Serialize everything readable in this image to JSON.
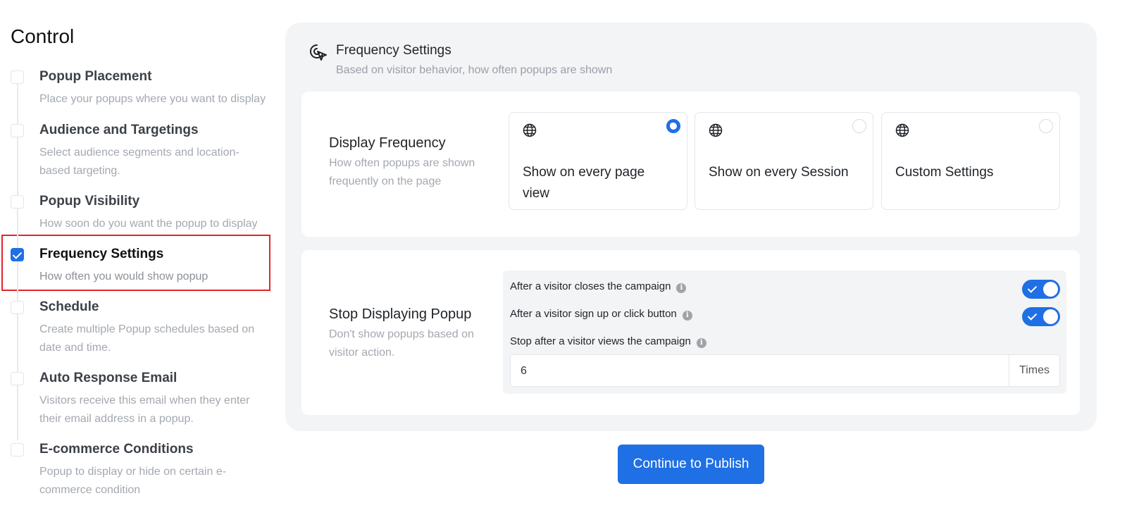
{
  "sidebar": {
    "title": "Control",
    "steps": [
      {
        "title": "Popup Placement",
        "desc": "Place your popups where you want to display",
        "checked": false
      },
      {
        "title": "Audience and Targetings",
        "desc": "Select audience segments and location-based targeting.",
        "checked": false
      },
      {
        "title": "Popup Visibility",
        "desc": "How soon do you want the popup to display",
        "checked": false
      },
      {
        "title": "Frequency Settings",
        "desc": "How often you would show popup",
        "checked": true
      },
      {
        "title": "Schedule",
        "desc": "Create multiple Popup schedules based on date and time.",
        "checked": false
      },
      {
        "title": "Auto Response Email",
        "desc": "Visitors receive this email when they enter their email address in a popup.",
        "checked": false
      },
      {
        "title": "E-commerce Conditions",
        "desc": "Popup to display or hide on certain e-commerce condition",
        "checked": false
      }
    ]
  },
  "header": {
    "icon": "cursor-click-icon",
    "title": "Frequency Settings",
    "subtitle": "Based on visitor behavior, how often popups are shown"
  },
  "display_frequency": {
    "title": "Display Frequency",
    "desc": "How often popups are shown frequently on the page",
    "options": [
      {
        "label": "Show on every page view",
        "icon": "globe-icon",
        "selected": true
      },
      {
        "label": "Show on every Session",
        "icon": "globe-icon",
        "selected": false
      },
      {
        "label": "Custom Settings",
        "icon": "globe-icon",
        "selected": false
      }
    ]
  },
  "stop_displaying": {
    "title": "Stop Displaying Popup",
    "desc": "Don't show popups based on visitor action.",
    "close_label": "After a visitor closes the campaign",
    "close_enabled": true,
    "signup_label": "After a visitor sign up or click button",
    "signup_enabled": true,
    "views_label": "Stop after a visitor views the campaign",
    "views_value": "6",
    "views_suffix": "Times"
  },
  "actions": {
    "publish_label": "Continue to Publish"
  },
  "colors": {
    "accent": "#1f6fe5",
    "highlight": "#e4242b",
    "panel_bg": "#f3f4f6"
  }
}
